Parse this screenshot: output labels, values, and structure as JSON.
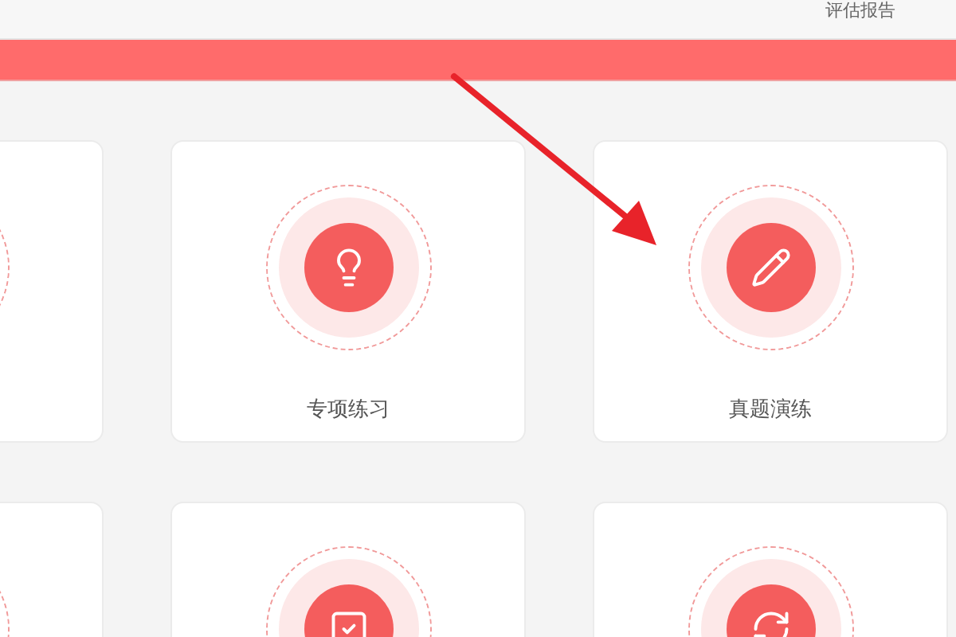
{
  "top_nav": {
    "items": [
      "评估报告"
    ]
  },
  "cards": [
    {
      "kind": "blank"
    },
    {
      "kind": "bulb",
      "label": "专项练习"
    },
    {
      "kind": "pencil",
      "label": "真题演练"
    },
    {
      "kind": "blank"
    },
    {
      "kind": "check"
    },
    {
      "kind": "refresh"
    }
  ]
}
